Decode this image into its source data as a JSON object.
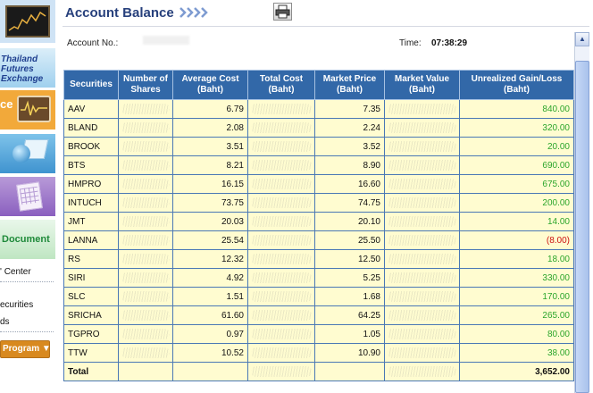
{
  "header": {
    "title": "Account Balance",
    "account_label": "Account No.:",
    "time_label": "Time:",
    "time_value": "07:38:29"
  },
  "sidebar": {
    "tfex_text": [
      "Thailand",
      "Futures",
      "Exchange"
    ],
    "service_text": "ce",
    "document_text": "Document",
    "links": [
      "' Center",
      "ecurities",
      "ds"
    ],
    "program_button": "Program"
  },
  "table": {
    "headers": [
      "Securities",
      "Number of Shares",
      "Average Cost (Baht)",
      "Total Cost (Baht)",
      "Market Price (Baht)",
      "Market Value (Baht)",
      "Unrealized Gain/Loss (Baht)"
    ],
    "rows": [
      {
        "sec": "AAV",
        "avg_cost": "6.79",
        "mkt_price": "7.35",
        "gain": "840.00",
        "status": "gain"
      },
      {
        "sec": "BLAND",
        "avg_cost": "2.08",
        "mkt_price": "2.24",
        "gain": "320.00",
        "status": "gain"
      },
      {
        "sec": "BROOK",
        "avg_cost": "3.51",
        "mkt_price": "3.52",
        "gain": "20.00",
        "status": "gain"
      },
      {
        "sec": "BTS",
        "avg_cost": "8.21",
        "mkt_price": "8.90",
        "gain": "690.00",
        "status": "gain"
      },
      {
        "sec": "HMPRO",
        "avg_cost": "16.15",
        "mkt_price": "16.60",
        "gain": "675.00",
        "status": "gain"
      },
      {
        "sec": "INTUCH",
        "avg_cost": "73.75",
        "mkt_price": "74.75",
        "gain": "200.00",
        "status": "gain"
      },
      {
        "sec": "JMT",
        "avg_cost": "20.03",
        "mkt_price": "20.10",
        "gain": "14.00",
        "status": "gain"
      },
      {
        "sec": "LANNA",
        "avg_cost": "25.54",
        "mkt_price": "25.50",
        "gain": "(8.00)",
        "status": "loss"
      },
      {
        "sec": "RS",
        "avg_cost": "12.32",
        "mkt_price": "12.50",
        "gain": "18.00",
        "status": "gain"
      },
      {
        "sec": "SIRI",
        "avg_cost": "4.92",
        "mkt_price": "5.25",
        "gain": "330.00",
        "status": "gain"
      },
      {
        "sec": "SLC",
        "avg_cost": "1.51",
        "mkt_price": "1.68",
        "gain": "170.00",
        "status": "gain"
      },
      {
        "sec": "SRICHA",
        "avg_cost": "61.60",
        "mkt_price": "64.25",
        "gain": "265.00",
        "status": "gain"
      },
      {
        "sec": "TGPRO",
        "avg_cost": "0.97",
        "mkt_price": "1.05",
        "gain": "80.00",
        "status": "gain"
      },
      {
        "sec": "TTW",
        "avg_cost": "10.52",
        "mkt_price": "10.90",
        "gain": "38.00",
        "status": "gain"
      }
    ],
    "total_label": "Total",
    "total_gain": "3,652.00"
  },
  "colors": {
    "header_bg": "#3268a8",
    "row_bg": "#fffcd0",
    "gain": "#2ba52b",
    "loss": "#cc1111",
    "title": "#27407c"
  },
  "icons": [
    "chart-icon",
    "globe-icon",
    "calendar-icon",
    "printer-icon",
    "chevrons-icon",
    "dropdown-arrow-icon",
    "scroll-up-icon"
  ]
}
